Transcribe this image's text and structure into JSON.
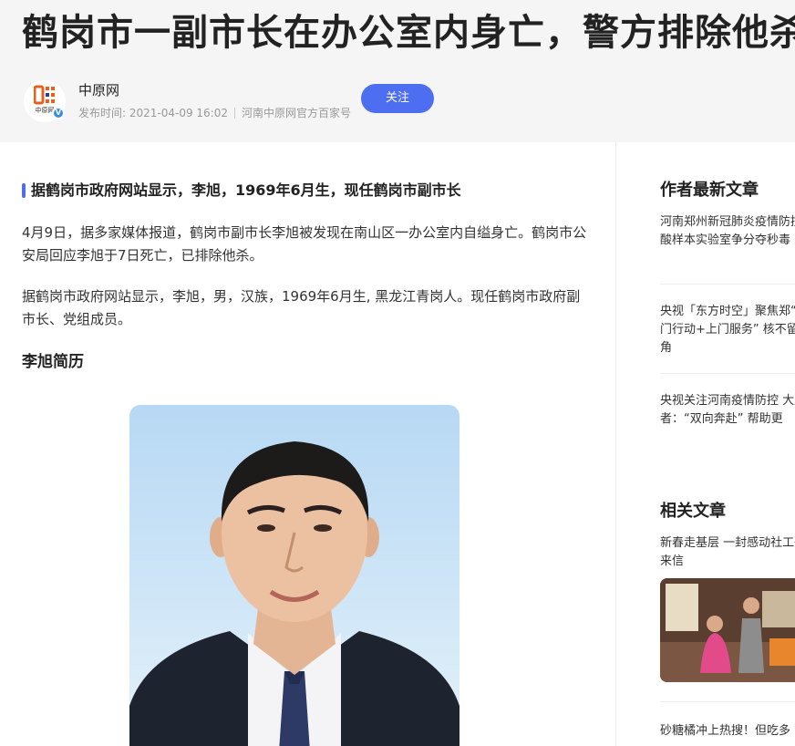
{
  "article": {
    "title": "鹤岗市一副市长在办公室内身亡，警方排除他杀",
    "author": {
      "name": "中原网",
      "logo_text": "中原网",
      "publish_time": "发布时间: 2021-04-09 16:02",
      "source": "河南中原网官方百家号",
      "follow_label": "关注",
      "verified_badge": "V"
    },
    "lead": "据鹤岗市政府网站显示，李旭，1969年6月生，现任鹤岗市副市长",
    "paragraphs": [
      "4月9日，据多家媒体报道，鹤岗市副市长李旭被发现在南山区一办公室内自缢身亡。鹤岗市公安局回应李旭于7日死亡，已排除他杀。",
      "据鹤岗市政府网站显示，李旭，男，汉族，1969年6月生, 黑龙江青岗人。现任鹤岗市政府副市长、党组成员。"
    ],
    "subheading": "李旭简历"
  },
  "sidebar": {
    "latest_title": "作者最新文章",
    "latest_items": [
      "河南郑州新冠肺炎疫情防控核酸样本实验室争分夺秒毒",
      "央视「东方时空」聚焦郑“敲门行动+上门服务” 核不留死角",
      "央视关注河南疫情防控 大愿者：“双向奔赴” 帮助更"
    ],
    "related_title": "相关文章",
    "related_items": [
      "新春走基层 一封感动社工殊来信",
      "砂糖橘冲上热搜！但吃多"
    ]
  },
  "colors": {
    "accent": "#4e6ef2",
    "header_bg": "#f5f5f5",
    "verified": "#3a8de6"
  },
  "icons": [
    "zhongyuan-logo-icon",
    "verified-badge-icon"
  ]
}
